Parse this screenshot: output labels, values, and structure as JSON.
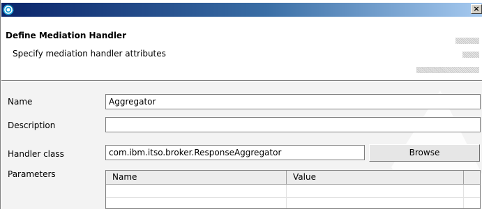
{
  "window": {
    "close_label": "×"
  },
  "header": {
    "title": "Define Mediation Handler",
    "description": "Specify mediation handler attributes"
  },
  "form": {
    "name_label": "Name",
    "name_value": "Aggregator",
    "description_label": "Description",
    "description_value": "",
    "handler_class_label": "Handler class",
    "handler_class_value": "com.ibm.itso.broker.ResponseAggregator",
    "browse_label": "Browse",
    "parameters_label": "Parameters",
    "parameters_table": {
      "columns": [
        "Name",
        "Value"
      ],
      "rows": []
    }
  }
}
